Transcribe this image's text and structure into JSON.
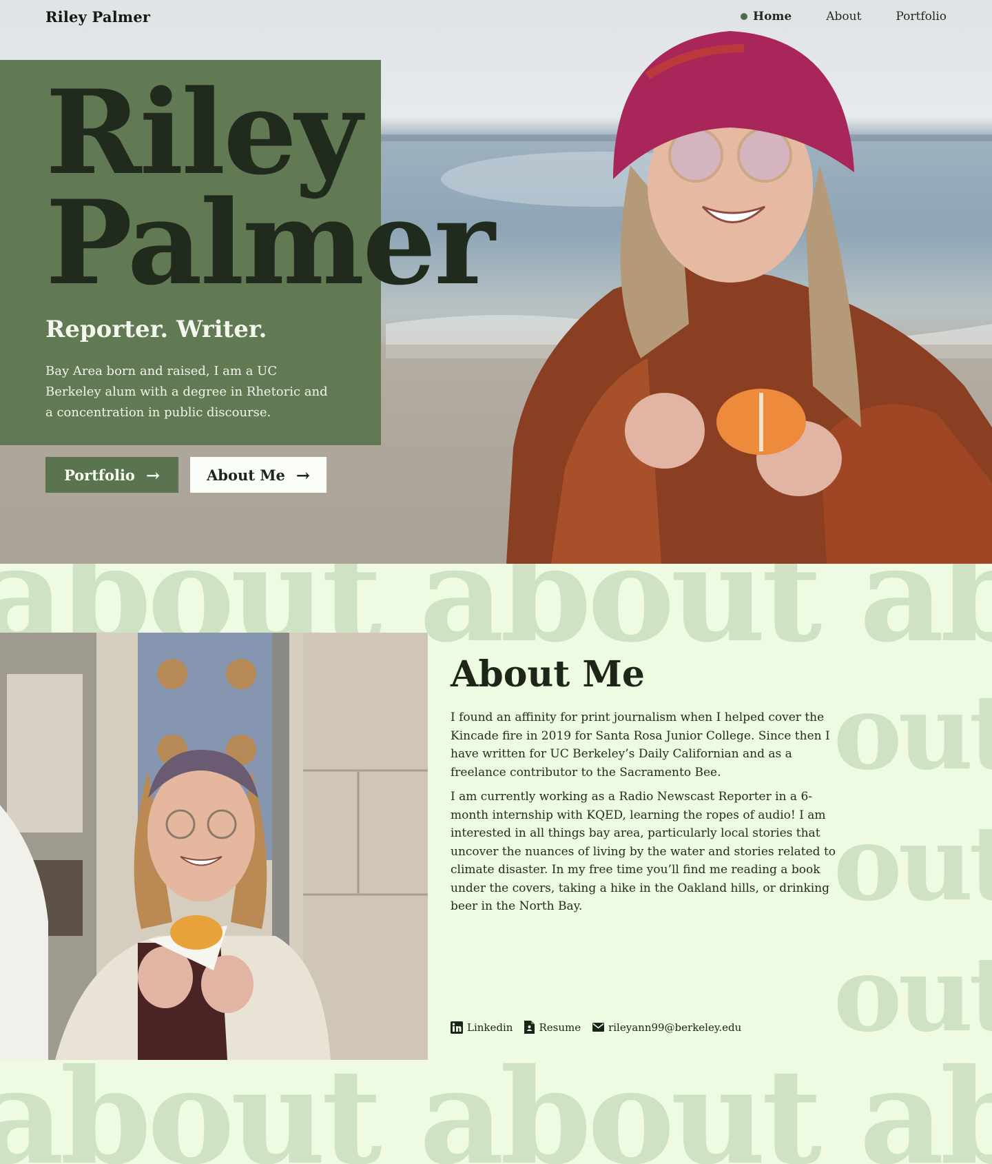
{
  "header": {
    "brand": "Riley Palmer",
    "nav": [
      {
        "label": "Home",
        "active": true
      },
      {
        "label": "About",
        "active": false
      },
      {
        "label": "Portfolio",
        "active": false
      }
    ]
  },
  "hero": {
    "name_line1": "Riley",
    "name_line2": "Palmer",
    "tagline": "Reporter. Writer.",
    "intro": "Bay Area born and raised, I am a UC Berkeley alum with a degree in Rhetoric and a concentration in public discourse.",
    "buttons": {
      "portfolio": "Portfolio",
      "about": "About Me"
    }
  },
  "about": {
    "ghost_word": "about about about",
    "ghost_side": "out",
    "title": "About Me",
    "paragraphs": [
      "I found an affinity for print journalism when I helped cover the Kincade fire in 2019 for Santa Rosa Junior College. Since then I have written for UC Berkeley’s Daily Californian and as a freelance contributor to the Sacramento Bee.",
      "I am currently working as a Radio Newscast Reporter in a 6-month internship with KQED, learning the ropes of audio! I am interested in all things bay area, particularly local stories that uncover the nuances of living by the water and stories related to climate disaster. In my free time you’ll find me reading a book under the covers, taking a hike in the Oakland hills, or drinking beer in the North Bay."
    ],
    "links": {
      "linkedin": "Linkedin",
      "resume": "Resume",
      "email": "rileyann99@berkeley.edu"
    }
  },
  "colors": {
    "panel_green": "#627a53",
    "button_green": "#5a7450",
    "about_bg": "#eefbe2",
    "ghost_text": "#cfe3c4"
  }
}
